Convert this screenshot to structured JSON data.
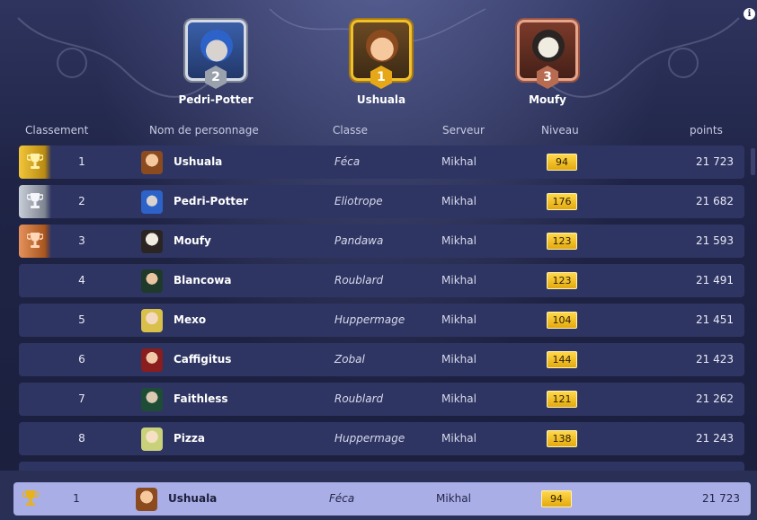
{
  "info_icon": "info-icon",
  "podium": [
    {
      "position": "2",
      "name": "Pedri-Potter",
      "icon": "pedri-potter-avatar"
    },
    {
      "position": "1",
      "name": "Ushuala",
      "icon": "ushuala-avatar"
    },
    {
      "position": "3",
      "name": "Moufy",
      "icon": "moufy-avatar"
    }
  ],
  "columns": {
    "classement": "Classement",
    "nom": "Nom de personnage",
    "classe": "Classe",
    "serveur": "Serveur",
    "niveau": "Niveau",
    "points": "points"
  },
  "colors": {
    "gold": "#f2c63a",
    "silver": "#c9ced8",
    "bronze": "#e5915b",
    "row_bg": "#2f3562",
    "level_badge": "#ffd84a",
    "highlight_row": "#a9aee6"
  },
  "rows": [
    {
      "rank": "1",
      "name": "Ushuala",
      "classe": "Féca",
      "serveur": "Mikhal",
      "niveau": "94",
      "points": "21 723",
      "trophy": "gold"
    },
    {
      "rank": "2",
      "name": "Pedri-Potter",
      "classe": "Eliotrope",
      "serveur": "Mikhal",
      "niveau": "176",
      "points": "21 682",
      "trophy": "silver"
    },
    {
      "rank": "3",
      "name": "Moufy",
      "classe": "Pandawa",
      "serveur": "Mikhal",
      "niveau": "123",
      "points": "21 593",
      "trophy": "bronze"
    },
    {
      "rank": "4",
      "name": "Blancowa",
      "classe": "Roublard",
      "serveur": "Mikhal",
      "niveau": "123",
      "points": "21 491",
      "trophy": ""
    },
    {
      "rank": "5",
      "name": "Mexo",
      "classe": "Huppermage",
      "serveur": "Mikhal",
      "niveau": "104",
      "points": "21 451",
      "trophy": ""
    },
    {
      "rank": "6",
      "name": "Caffigitus",
      "classe": "Zobal",
      "serveur": "Mikhal",
      "niveau": "144",
      "points": "21 423",
      "trophy": ""
    },
    {
      "rank": "7",
      "name": "Faithless",
      "classe": "Roublard",
      "serveur": "Mikhal",
      "niveau": "121",
      "points": "21 262",
      "trophy": ""
    },
    {
      "rank": "8",
      "name": "Pizza",
      "classe": "Huppermage",
      "serveur": "Mikhal",
      "niveau": "138",
      "points": "21 243",
      "trophy": ""
    }
  ],
  "current_player": {
    "rank": "1",
    "name": "Ushuala",
    "classe": "Féca",
    "serveur": "Mikhal",
    "niveau": "94",
    "points": "21 723",
    "trophy": "gold"
  }
}
